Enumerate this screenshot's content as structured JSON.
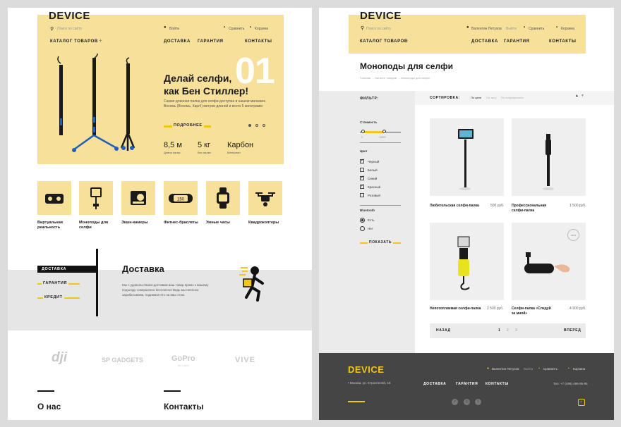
{
  "left": {
    "logo": "DEVICE",
    "header": {
      "search_placeholder": "Поиск по сайту",
      "login": "Войти",
      "compare": "Сравнить",
      "cart": "Корзина"
    },
    "nav": {
      "catalog": "КАТАЛОГ ТОВАРОВ",
      "delivery": "ДОСТАВКА",
      "warranty": "ГАРАНТИЯ",
      "contacts": "КОНТАКТЫ"
    },
    "hero": {
      "number": "01",
      "title_line1": "Делай селфи,",
      "title_line2": "как Бен Стиллер!",
      "desc": "Самая длинная палка для селфи доступна в нашем магазине. Восемь (Восемь, Карл!) метров длиной и всего 5 килограмм",
      "more_button": "ПОДРОБНЕЕ",
      "specs": [
        {
          "value": "8,5 м",
          "label": "Длина палки"
        },
        {
          "value": "5 кг",
          "label": "Вес палки"
        },
        {
          "value": "Карбон",
          "label": "Материал"
        }
      ]
    },
    "categories": [
      {
        "icon": "vr-headset-icon",
        "label": "Виртуальная реальность"
      },
      {
        "icon": "monopod-icon",
        "label": "Моноподы для селфи"
      },
      {
        "icon": "action-camera-icon",
        "label": "Экшн-камеры"
      },
      {
        "icon": "fitness-band-icon",
        "label": "Фитнес-браслеты"
      },
      {
        "icon": "smartwatch-icon",
        "label": "Умные часы"
      },
      {
        "icon": "drone-icon",
        "label": "Квадрокоптеры"
      }
    ],
    "fitness_band_readout": "150",
    "services": {
      "tabs": [
        "ДОСТАВКА",
        "ГАРАНТИЯ",
        "КРЕДИТ"
      ],
      "title": "Доставка",
      "desc": "Мы с удовольствием доставим ваш товар прямо к вашему подъезду совершенно бесплатно! Ведь мы неплохо зарабатываем, поднимая его на ваш этаж."
    },
    "brands": [
      "dji",
      "SP GADGETS",
      "GoPro",
      "VIVE"
    ],
    "gopro_sub": "BE A HERO",
    "about_title": "О нас",
    "contacts_title": "Контакты"
  },
  "right": {
    "logo": "DEVICE",
    "header": {
      "search_placeholder": "Поиск по сайту",
      "user": "Валентин Петухов",
      "logout": "Выйти",
      "compare": "Сравнить",
      "cart": "Корзина"
    },
    "nav": {
      "catalog": "КАТАЛОГ ТОВАРОВ",
      "delivery": "ДОСТАВКА",
      "warranty": "ГАРАНТИЯ",
      "contacts": "КОНТАКТЫ"
    },
    "page_title": "Моноподы для селфи",
    "breadcrumbs": [
      "Главная",
      "Каталог товаров",
      "Моноподы для селфи"
    ],
    "filter_label": "ФИЛЬТР:",
    "sort": {
      "label": "СОРТИРОВКА:",
      "options": [
        "По цене",
        "По типу",
        "По популярности"
      ]
    },
    "price": {
      "label": "Стоимость",
      "min": "0",
      "max": "15000"
    },
    "color": {
      "label": "Цвет",
      "options": [
        {
          "label": "Черный",
          "checked": true
        },
        {
          "label": "Белый",
          "checked": false
        },
        {
          "label": "Синий",
          "checked": true
        },
        {
          "label": "Красный",
          "checked": true
        },
        {
          "label": "Розовый",
          "checked": false
        }
      ]
    },
    "bluetooth": {
      "label": "Bluetooth",
      "options": [
        {
          "label": "Есть",
          "checked": true
        },
        {
          "label": "Нет",
          "checked": false
        }
      ]
    },
    "show_button": "ПОКАЗАТЬ",
    "products": [
      {
        "name": "Любительская селфи-палка",
        "price": "500 руб."
      },
      {
        "name": "Профессиональная селфи-палка",
        "price": "1 500 руб."
      },
      {
        "name": "Непотопляемая селфи-палка",
        "price": "2 500 руб."
      },
      {
        "name": "Селфи-палка «Следуй за мной»",
        "price": "4 900 руб.",
        "badge": "new"
      }
    ],
    "pagination": {
      "prev": "НАЗАД",
      "pages": [
        "1",
        "2",
        "3"
      ],
      "next": "ВПЕРЕД"
    },
    "footer": {
      "logo": "DEVICE",
      "user": "Валентин Петухов",
      "logout": "Выйти",
      "compare": "Сравнить",
      "cart": "Корзина",
      "address": "Москва, ул. Строителей, 15",
      "nav": [
        "ДОСТАВКА",
        "ГАРАНТИЯ",
        "КОНТАКТЫ"
      ],
      "phone": "Тел: +7 (495) 495-95-95",
      "social": [
        "vk-icon",
        "instagram-icon",
        "twitter-icon"
      ]
    },
    "colors": {
      "accent": "#f2c618",
      "yellow_bg": "#f7e09a",
      "footer_bg": "#454545"
    }
  }
}
